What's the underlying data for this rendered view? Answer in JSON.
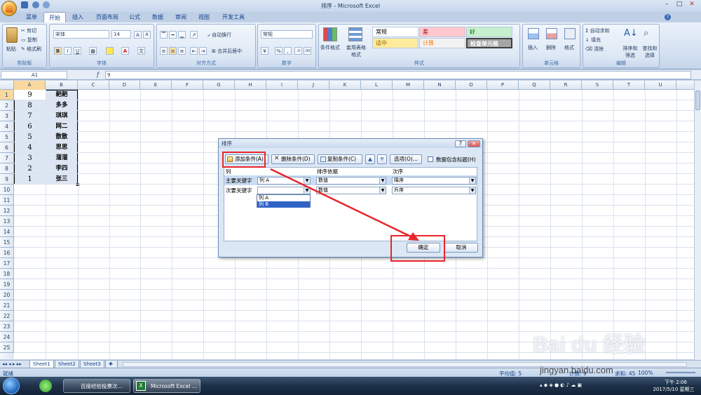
{
  "window": {
    "title": "排序 - Microsoft Excel"
  },
  "tabs": [
    "菜单",
    "开始",
    "插入",
    "页面布局",
    "公式",
    "数据",
    "审阅",
    "视图",
    "开发工具"
  ],
  "ribbon": {
    "clipboard": {
      "label": "剪贴板",
      "paste": "粘贴",
      "cut": "剪切",
      "copy": "复制",
      "format_painter": "格式刷"
    },
    "font": {
      "label": "字体",
      "name": "宋体",
      "size": "14",
      "bold": "B",
      "italic": "I",
      "underline": "U",
      "grow": "A",
      "shrink": "A",
      "color": "A"
    },
    "alignment": {
      "label": "对齐方式",
      "wrap": "自动换行",
      "merge": "合并后居中"
    },
    "number": {
      "label": "数字",
      "format": "常规",
      "percent": "%",
      "comma": ","
    },
    "styles": {
      "label": "样式",
      "cond_format": "条件格式",
      "table_format": "套用表格格式",
      "normal": "常规",
      "bad": "差",
      "good": "好",
      "neutral": "适中",
      "calc": "计算",
      "check": "检查单元格"
    },
    "cells": {
      "label": "单元格",
      "insert": "插入",
      "delete": "删除",
      "format": "格式"
    },
    "editing": {
      "label": "编辑",
      "autosum": "自动求和",
      "fill": "填充",
      "clear": "清除",
      "sort_filter": "排序和筛选",
      "find_select": "查找和选择"
    }
  },
  "formula_bar": {
    "name_box": "A1",
    "fx": "f",
    "value": "9"
  },
  "columns": [
    "A",
    "B",
    "C",
    "D",
    "E",
    "F",
    "G",
    "H",
    "I",
    "J",
    "K",
    "L",
    "M",
    "N",
    "O",
    "P",
    "Q",
    "R",
    "S",
    "T",
    "U"
  ],
  "rows": [
    "1",
    "2",
    "3",
    "4",
    "5",
    "6",
    "7",
    "8",
    "9",
    "10",
    "11",
    "12",
    "13",
    "14",
    "15",
    "16",
    "17",
    "18",
    "19",
    "20",
    "21",
    "22",
    "23",
    "24",
    "25"
  ],
  "cells": [
    {
      "a": "9",
      "b": "耙耙"
    },
    {
      "a": "8",
      "b": "多多"
    },
    {
      "a": "7",
      "b": "琪琪"
    },
    {
      "a": "6",
      "b": "网二"
    },
    {
      "a": "5",
      "b": "散散"
    },
    {
      "a": "4",
      "b": "思思"
    },
    {
      "a": "3",
      "b": "溜溜"
    },
    {
      "a": "2",
      "b": "李四"
    },
    {
      "a": "1",
      "b": "张三"
    }
  ],
  "sheets": [
    "Sheet1",
    "Sheet2",
    "Sheet3"
  ],
  "status": {
    "ready": "就绪",
    "average": "平均值: 5",
    "count": "计数: 9",
    "sum": "求和: 45",
    "zoom": "100%"
  },
  "dialog": {
    "title": "排序",
    "help": "?",
    "close": "✕",
    "add_level": "添加条件(A)",
    "delete_level": "删除条件(D)",
    "copy_level": "复制条件(C)",
    "options": "选项(O)...",
    "has_header": "数据包含标题(H)",
    "col_header": "列",
    "sorton_header": "排序依据",
    "order_header": "次序",
    "row1": {
      "label": "主要关键字",
      "column": "列 A",
      "sort_on": "数值",
      "order": "降序"
    },
    "row2": {
      "label": "次要关键字",
      "column": "",
      "sort_on": "数值",
      "order": "升序"
    },
    "dropdown_options": [
      "列 A",
      "列 B"
    ],
    "ok": "确定",
    "cancel": "取消"
  },
  "taskbar": {
    "items": [
      "百度经验投票次...",
      "Microsoft Excel ..."
    ],
    "time": "下午 2:06",
    "date": "2017/5/10 星期三"
  },
  "watermark": {
    "text": "Bai du 经验",
    "url": "jingyan.baidu.com"
  }
}
